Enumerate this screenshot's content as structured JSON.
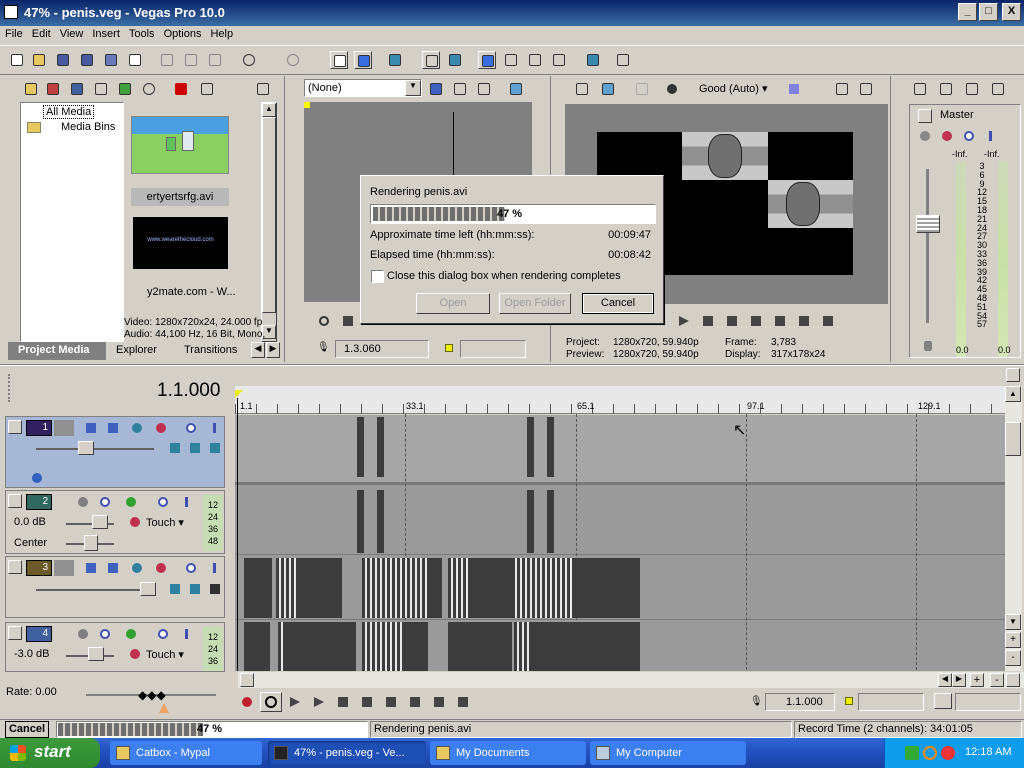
{
  "window": {
    "title": "47% - penis.veg - Vegas Pro 10.0",
    "minimize": "_",
    "maximize": "□",
    "close": "X"
  },
  "menu": [
    "File",
    "Edit",
    "View",
    "Insert",
    "Tools",
    "Options",
    "Help"
  ],
  "explorer": {
    "tree": [
      {
        "label": "All Media"
      },
      {
        "label": "Media Bins"
      }
    ],
    "thumbs": [
      {
        "label": "ertyertsrfg.avi"
      },
      {
        "label": "y2mate.com - W..."
      }
    ],
    "thumb_caption": "www.wearethecloud.com",
    "info_video": "Video: 1280x720x24, 24.000 fp",
    "info_audio": "Audio: 44,100 Hz, 16 Bit, Mono,",
    "tabs": [
      "Project Media",
      "Explorer",
      "Transitions"
    ]
  },
  "trimmer": {
    "dropdown": "(None)",
    "timecode": "1.3.060"
  },
  "preview": {
    "quality": "Good (Auto)",
    "project_label": "Project:",
    "project": "1280x720, 59.940p",
    "preview_label": "Preview:",
    "preview_val": "1280x720, 59.940p",
    "frame_label": "Frame:",
    "frame": "3,783",
    "display_label": "Display:",
    "display": "317x178x24"
  },
  "mixer": {
    "master": "Master",
    "scale_top": [
      "-Inf.",
      "-Inf."
    ],
    "scale": [
      "3",
      "6",
      "9",
      "12",
      "15",
      "18",
      "21",
      "24",
      "27",
      "30",
      "33",
      "36",
      "39",
      "42",
      "45",
      "48",
      "51",
      "54",
      "57"
    ],
    "bottom": [
      "0.0",
      "0.0"
    ]
  },
  "timeline": {
    "timecode": "1.1.000",
    "ruler": [
      "1.1",
      "33.1",
      "65.1",
      "97.1",
      "129.1"
    ],
    "rate": "Rate: 0.00",
    "end_timecode": "1.1.000"
  },
  "tracks": [
    {
      "num": "1",
      "type": "video"
    },
    {
      "num": "2",
      "type": "audio",
      "vol": "0.0 dB",
      "pan": "Center",
      "mode": "Touch",
      "meter": [
        "12",
        "24",
        "36",
        "48"
      ]
    },
    {
      "num": "3",
      "type": "video"
    },
    {
      "num": "4",
      "type": "audio",
      "vol": "-3.0 dB",
      "mode": "Touch",
      "meter": [
        "12",
        "24",
        "36"
      ]
    }
  ],
  "dialog": {
    "title": "Rendering penis.avi",
    "percent": "47 %",
    "progress": 0.47,
    "time_left_label": "Approximate time left (hh:mm:ss):",
    "time_left": "00:09:47",
    "elapsed_label": "Elapsed time (hh:mm:ss):",
    "elapsed": "00:08:42",
    "checkbox_label": "Close this dialog box when rendering completes",
    "open": "Open",
    "open_folder": "Open Folder",
    "cancel": "Cancel"
  },
  "statusbar": {
    "cancel": "Cancel",
    "percent": "47 %",
    "progress": 0.47,
    "message": "Rendering penis.avi",
    "record_time": "Record Time (2 channels): 34:01:05"
  },
  "taskbar": {
    "start": "start",
    "tasks": [
      "Catbox - Mypal",
      "47% - penis.veg - Ve...",
      "My Documents",
      "My Computer"
    ],
    "clock": "12:18 AM"
  }
}
